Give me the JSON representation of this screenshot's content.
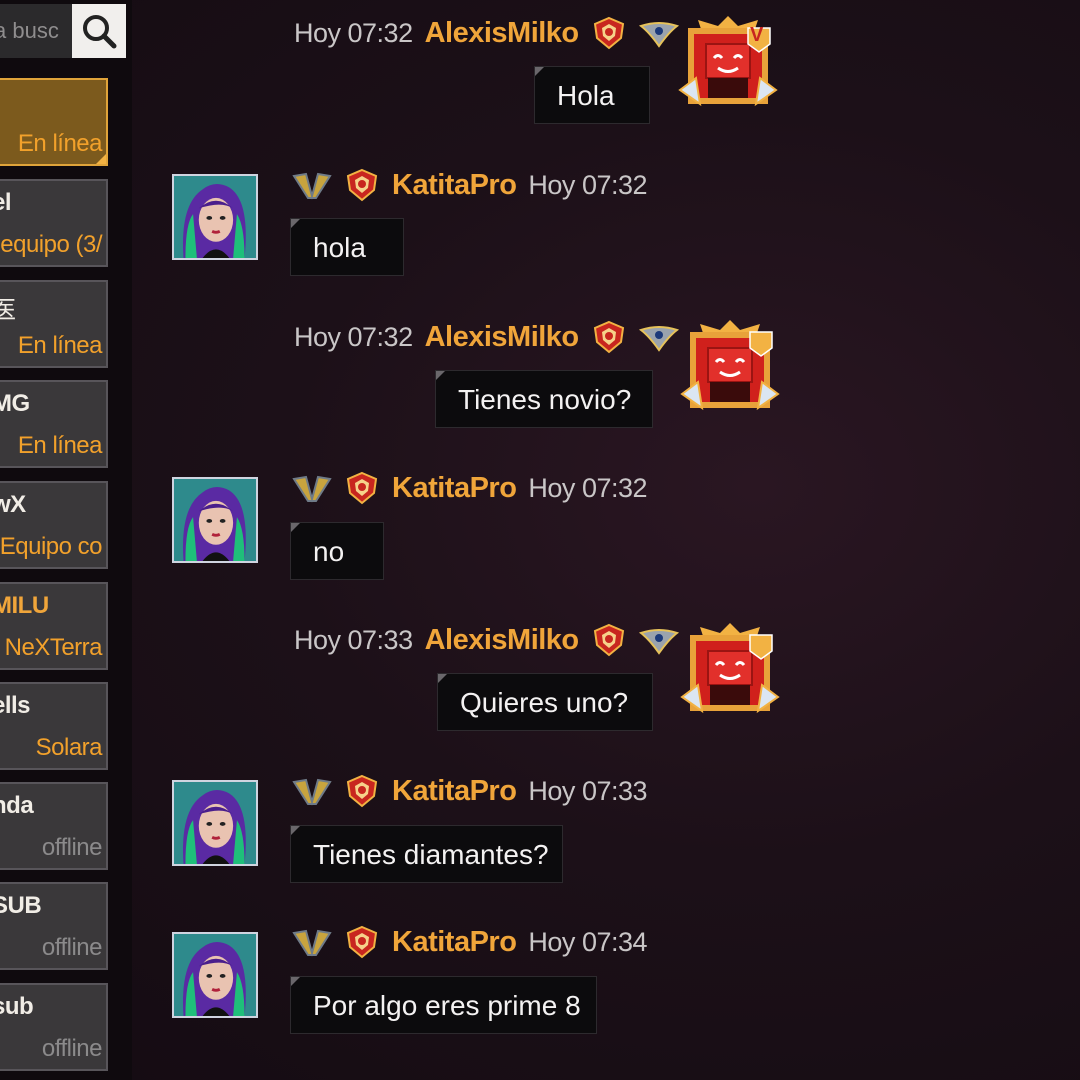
{
  "sidebar": {
    "search_placeholder": "a busc",
    "friends": [
      {
        "name": "",
        "status": "En línea",
        "selected": true
      },
      {
        "name": "el",
        "status": "equipo (3/"
      },
      {
        "name": "医",
        "status": "En línea"
      },
      {
        "name": "MG",
        "status": "En línea"
      },
      {
        "name": "wX",
        "status": "Equipo co"
      },
      {
        "name": "MILU",
        "status": "NeXTerra"
      },
      {
        "name": "ells",
        "status": "Solara"
      },
      {
        "name": "nda",
        "status": "offline"
      },
      {
        "name": "SUB",
        "status": "offline"
      },
      {
        "name": "sub",
        "status": "offline"
      }
    ]
  },
  "chat": {
    "messages": [
      {
        "side": "me",
        "user": "AlexisMilko",
        "time": "Hoy 07:32",
        "text": "Hola"
      },
      {
        "side": "other",
        "user": "KatitaPro",
        "time": "Hoy 07:32",
        "text": "hola"
      },
      {
        "side": "me",
        "user": "AlexisMilko",
        "time": "Hoy 07:32",
        "text": "Tienes novio?"
      },
      {
        "side": "other",
        "user": "KatitaPro",
        "time": "Hoy 07:32",
        "text": "no"
      },
      {
        "side": "me",
        "user": "AlexisMilko",
        "time": "Hoy 07:33",
        "text": "Quieres uno?"
      },
      {
        "side": "other",
        "user": "KatitaPro",
        "time": "Hoy 07:33",
        "text": "Tienes diamantes?"
      },
      {
        "side": "other",
        "user": "KatitaPro",
        "time": "Hoy 07:34",
        "text": "Por algo eres prime 8"
      }
    ],
    "vip_badge_letter": "V"
  },
  "colors": {
    "accent": "#f0a53a",
    "bubble": "#0c0b0d",
    "offline": "#8b8a8b"
  }
}
